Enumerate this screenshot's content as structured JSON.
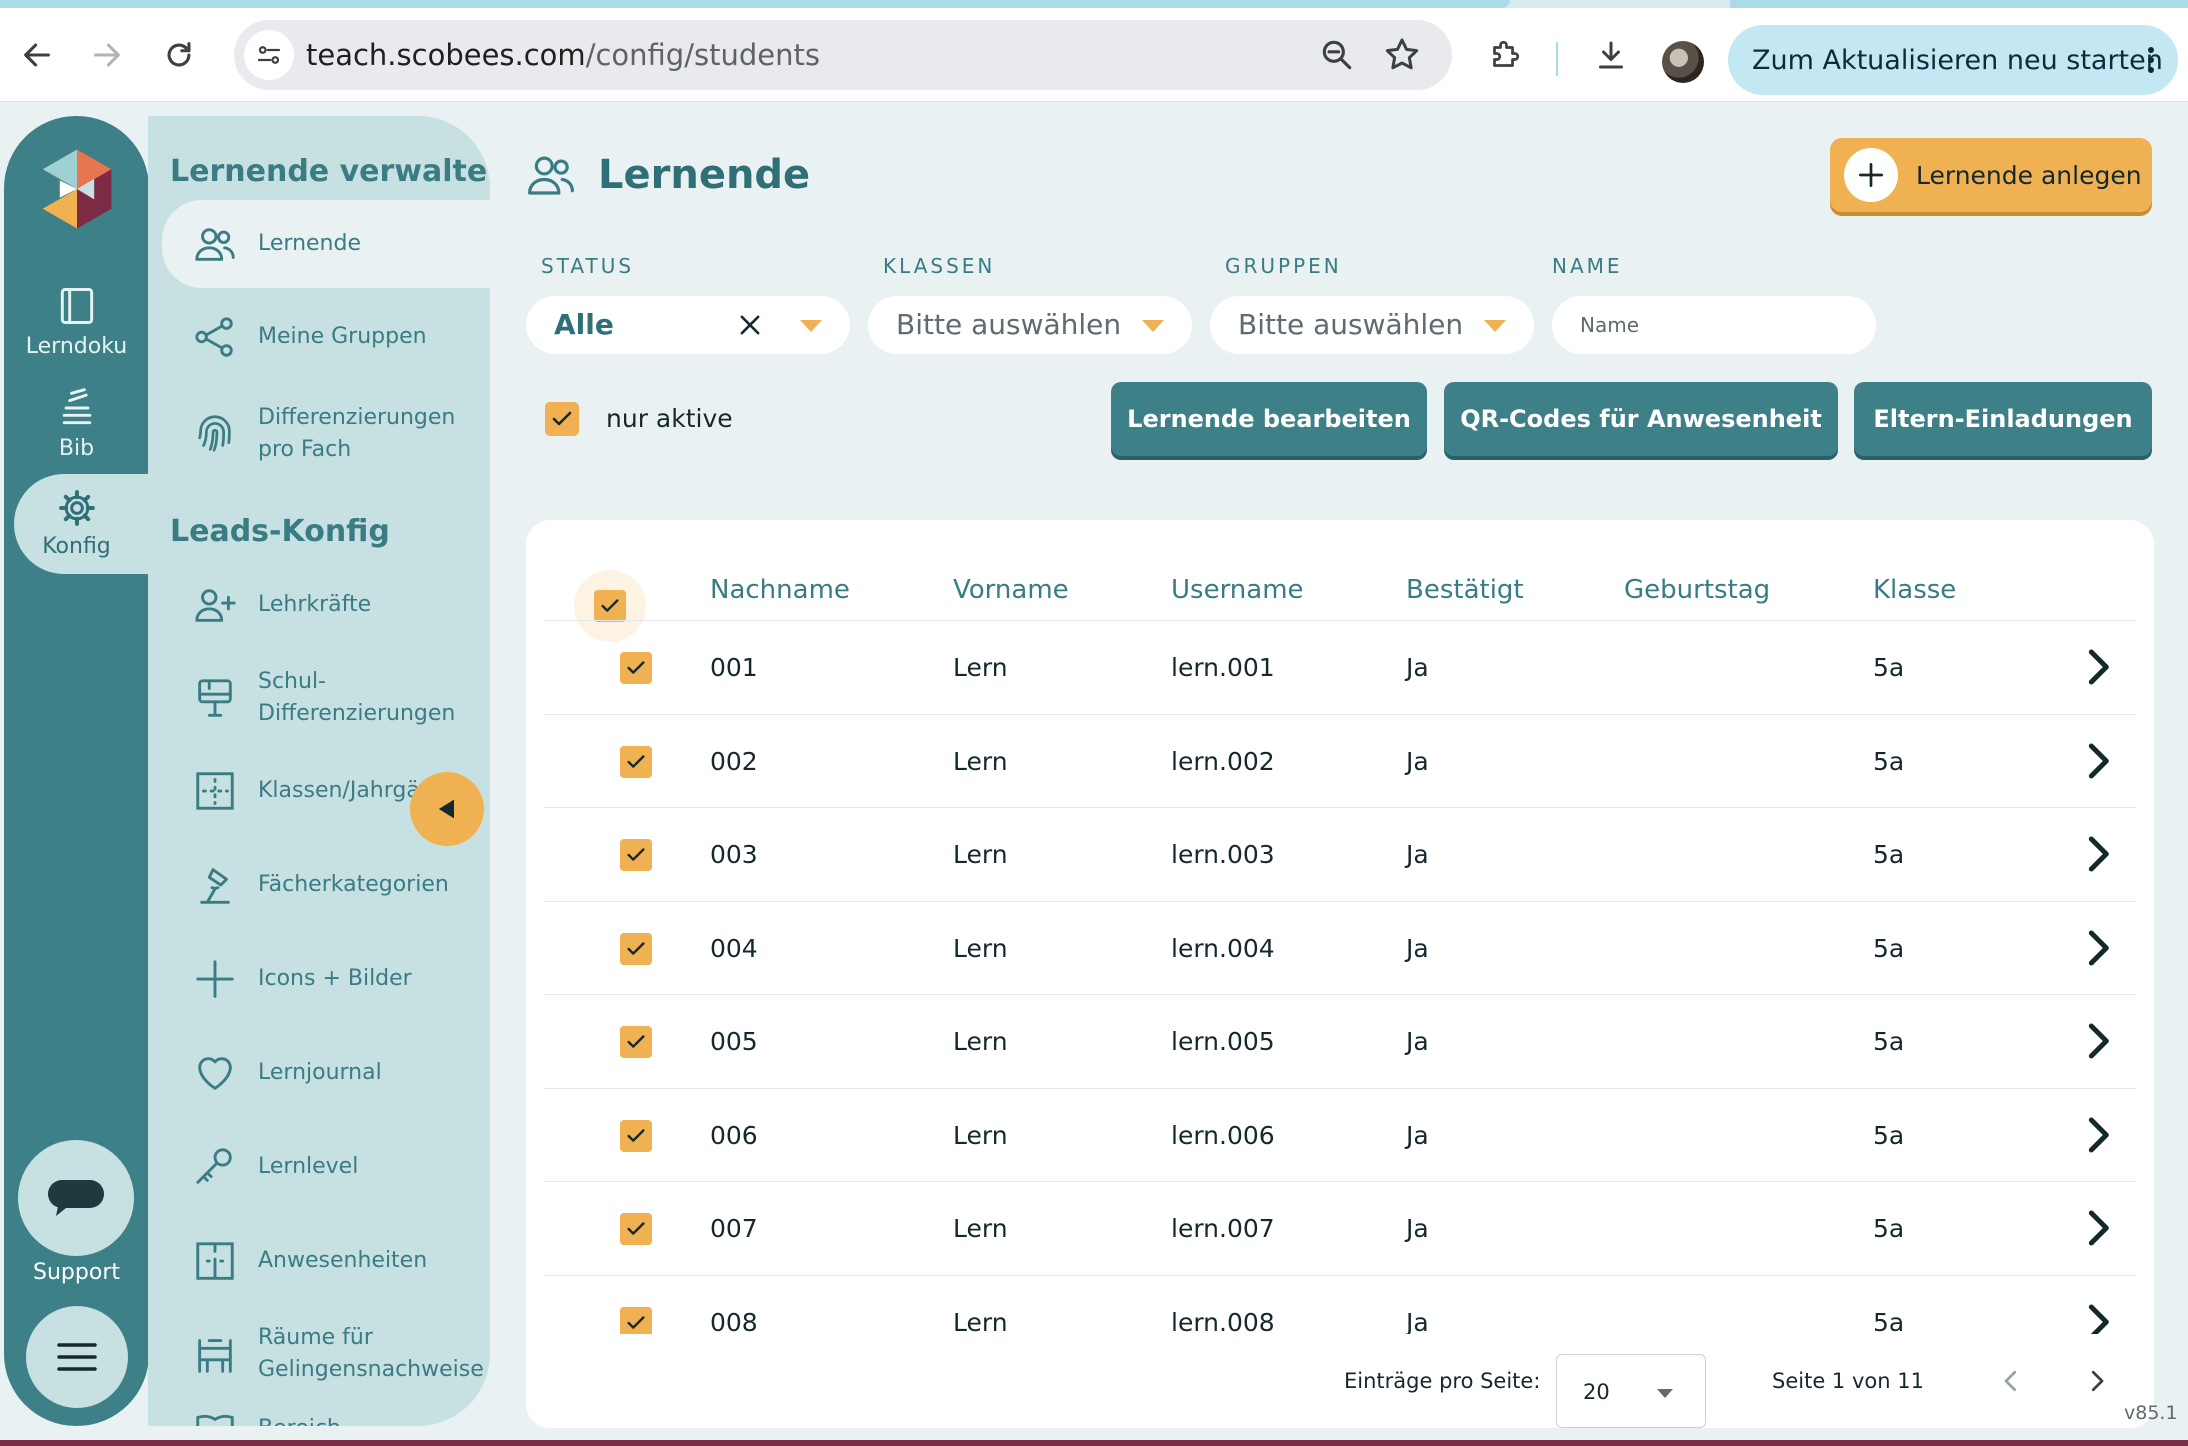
{
  "browser": {
    "url_host": "teach.scobees.com",
    "url_path": "/config/students",
    "update_button": "Zum Aktualisieren neu starten"
  },
  "rail": {
    "items": [
      {
        "label": "Lerndoku"
      },
      {
        "label": "Bib"
      },
      {
        "label": "Konfig"
      }
    ],
    "support_label": "Support"
  },
  "subnav": {
    "heading_manage": "Lernende verwalten",
    "heading_leads": "Leads-Konfig",
    "items": [
      {
        "label": "Lernende",
        "icon": "users-icon"
      },
      {
        "label": "Meine Gruppen",
        "icon": "share-nodes-icon"
      },
      {
        "label": "Differenzierungen pro Fach",
        "icon": "fingerprint-icon"
      },
      {
        "label": "Lehrkräfte",
        "icon": "user-plus-icon"
      },
      {
        "label": "Schul-Differenzierungen",
        "icon": "board-icon"
      },
      {
        "label": "Klassen/Jahrgä",
        "icon": "grid-dots-icon"
      },
      {
        "label": "Fächerkategorien",
        "icon": "lamp-icon"
      },
      {
        "label": "Icons + Bilder",
        "icon": "plus-icon"
      },
      {
        "label": "Lernjournal",
        "icon": "heart-icon"
      },
      {
        "label": "Lernlevel",
        "icon": "key-icon"
      },
      {
        "label": "Anwesenheiten",
        "icon": "door-icon"
      },
      {
        "label": "Räume für Gelingensnachweise",
        "icon": "bench-icon"
      },
      {
        "label": "Bereich",
        "icon": "book-icon"
      }
    ]
  },
  "page": {
    "title": "Lernende",
    "add_button": "Lernende anlegen"
  },
  "filters": {
    "status_label": "STATUS",
    "status_value": "Alle",
    "classes_label": "KLASSEN",
    "classes_value": "Bitte auswählen",
    "groups_label": "GRUPPEN",
    "groups_value": "Bitte auswählen",
    "name_label": "NAME",
    "name_placeholder": "Name",
    "only_active_label": "nur aktive"
  },
  "actions": {
    "edit": "Lernende bearbeiten",
    "qr": "QR-Codes für Anwesenheit",
    "parents": "Eltern-Einladungen"
  },
  "table": {
    "headers": {
      "lastname": "Nachname",
      "firstname": "Vorname",
      "username": "Username",
      "confirmed": "Bestätigt",
      "birthday": "Geburtstag",
      "class": "Klasse"
    },
    "rows": [
      {
        "lastname": "001",
        "firstname": "Lern",
        "username": "lern.001",
        "confirmed": "Ja",
        "birthday": "",
        "class": "5a"
      },
      {
        "lastname": "002",
        "firstname": "Lern",
        "username": "lern.002",
        "confirmed": "Ja",
        "birthday": "",
        "class": "5a"
      },
      {
        "lastname": "003",
        "firstname": "Lern",
        "username": "lern.003",
        "confirmed": "Ja",
        "birthday": "",
        "class": "5a"
      },
      {
        "lastname": "004",
        "firstname": "Lern",
        "username": "lern.004",
        "confirmed": "Ja",
        "birthday": "",
        "class": "5a"
      },
      {
        "lastname": "005",
        "firstname": "Lern",
        "username": "lern.005",
        "confirmed": "Ja",
        "birthday": "",
        "class": "5a"
      },
      {
        "lastname": "006",
        "firstname": "Lern",
        "username": "lern.006",
        "confirmed": "Ja",
        "birthday": "",
        "class": "5a"
      },
      {
        "lastname": "007",
        "firstname": "Lern",
        "username": "lern.007",
        "confirmed": "Ja",
        "birthday": "",
        "class": "5a"
      },
      {
        "lastname": "008",
        "firstname": "Lern",
        "username": "lern.008",
        "confirmed": "Ja",
        "birthday": "",
        "class": "5a"
      }
    ]
  },
  "pager": {
    "per_page_label": "Einträge pro Seite:",
    "per_page_value": "20",
    "page_info": "Seite 1 von 11"
  },
  "version": "v85.1",
  "colors": {
    "teal": "#3e8088",
    "teal_light": "#c7e0e2",
    "accent": "#efb151",
    "background": "#e9f1f2"
  }
}
